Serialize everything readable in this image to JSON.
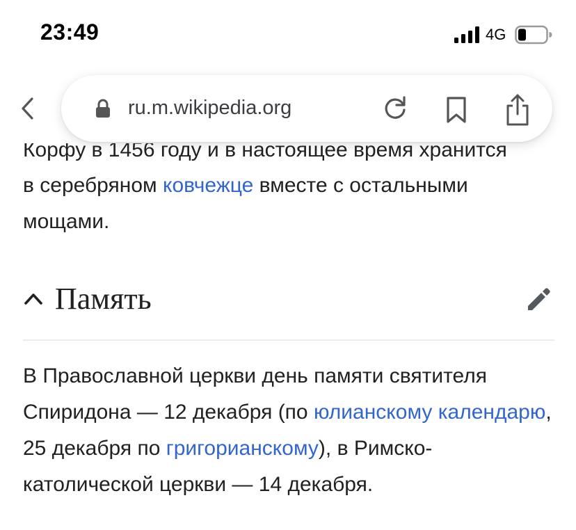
{
  "status": {
    "time": "23:49",
    "network": "4G",
    "icons": [
      "signal-icon",
      "battery-icon"
    ]
  },
  "browser": {
    "url": "ru.m.wikipedia.org",
    "icons": [
      "back-icon",
      "lock-icon",
      "reload-icon",
      "bookmark-icon",
      "share-icon"
    ]
  },
  "article": {
    "clipped_line": "Корфу в 1456 году и в настоящее время хранится",
    "p1": {
      "t1": "в серебряном ",
      "link1": "ковчежце",
      "t2": " вместе с остальными мощами."
    },
    "section": {
      "title": "Память",
      "icons": [
        "chevron-up-icon",
        "edit-pencil-icon"
      ]
    },
    "p2": {
      "t1": "В Православной церкви день памяти святителя Спиридона — 12 декабря (по ",
      "link1": "юлианскому календарю",
      "t2": ", 25 декабря по ",
      "link2": "григорианскому",
      "t3": "), в Римско-католической церкви — 14 декабря."
    }
  },
  "colors": {
    "link": "#3366cc",
    "text": "#202122",
    "divider": "#eaecf0"
  }
}
